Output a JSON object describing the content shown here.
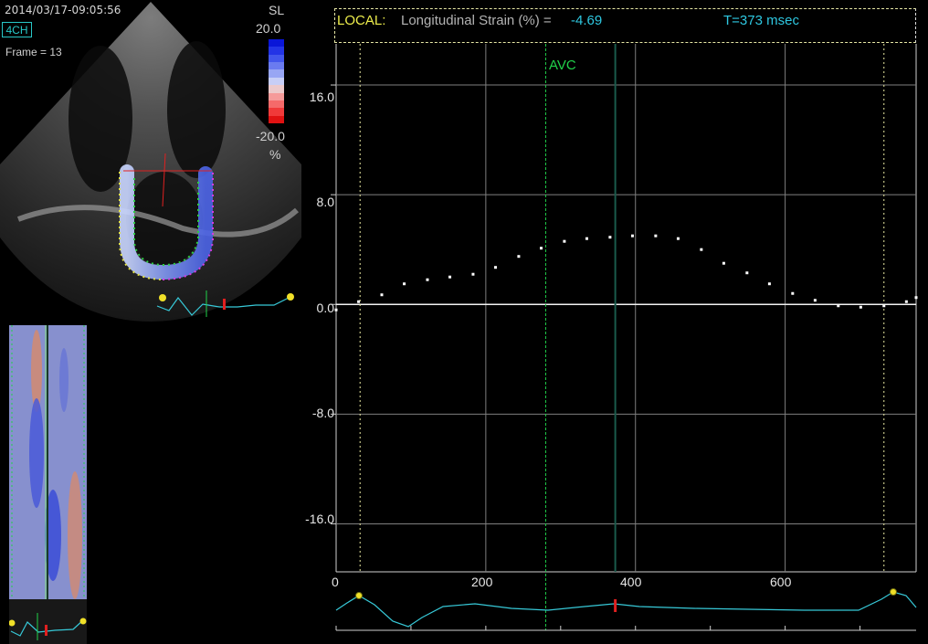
{
  "header": {
    "timestamp": "2014/03/17-09:05:56",
    "view": "4CH",
    "frame": "Frame = 13"
  },
  "colorbar": {
    "param": "SL",
    "max_label": "20.0",
    "min_label": "-20.0",
    "unit": "%",
    "colors": [
      "#0a16d8",
      "#2334e6",
      "#4256ec",
      "#6a7bf0",
      "#98a6f4",
      "#c7cef6",
      "#ecc9cb",
      "#f59a9a",
      "#f56a6a",
      "#f03a3a",
      "#e01212"
    ]
  },
  "readout": {
    "mode": "LOCAL:",
    "parameter": "Longitudinal Strain (%) =",
    "value": "-4.69",
    "time": "T=373 msec"
  },
  "avc_label": "AVC",
  "colors": {
    "background": "#000000",
    "grid": "#7f7f7f",
    "avc": "#21d24a",
    "cursor": "#1a5a4c",
    "ecg": "#37c9d8",
    "markers": "#ffffff"
  },
  "chart_data": {
    "type": "scatter",
    "xlim": [
      0,
      775
    ],
    "ylim": [
      -19.5,
      19
    ],
    "x_ticks": [
      "0",
      "200",
      "400",
      "600"
    ],
    "y_ticks": [
      "16.0",
      "8.0",
      "0.0",
      "-8.0",
      "-16.0"
    ],
    "avc_time": 280,
    "cursor_time": 373,
    "x": [
      0,
      30,
      61,
      91,
      122,
      152,
      183,
      213,
      244,
      274,
      305,
      335,
      366,
      396,
      427,
      457,
      488,
      518,
      549,
      579,
      610,
      640,
      671,
      701,
      732,
      762,
      775
    ],
    "y": [
      -0.4,
      0.2,
      0.7,
      1.5,
      1.8,
      2.0,
      2.2,
      2.7,
      3.5,
      4.1,
      4.6,
      4.8,
      4.9,
      5.0,
      5.0,
      4.8,
      4.0,
      3.0,
      2.3,
      1.5,
      0.8,
      0.3,
      -0.1,
      -0.2,
      -0.1,
      0.2,
      0.5
    ]
  }
}
